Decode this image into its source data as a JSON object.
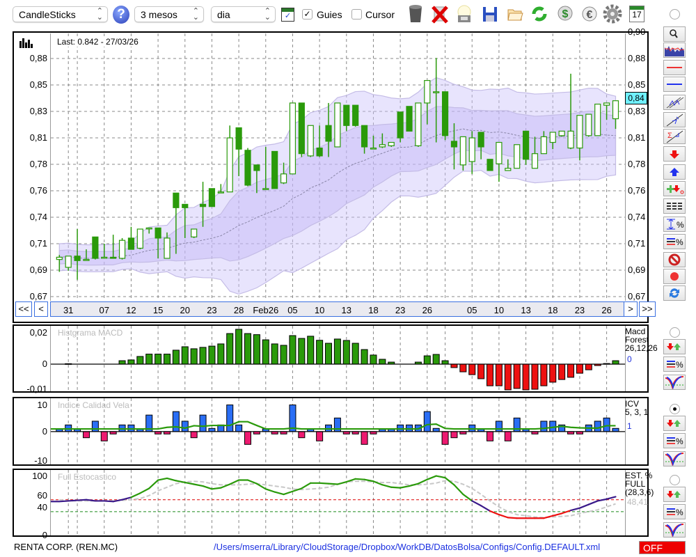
{
  "toolbar": {
    "chart_type": "CandleSticks",
    "period": "3 mesos",
    "interval": "dia",
    "help_label": "?",
    "guides_label": "Guies",
    "guides_checked": true,
    "cursor_label": "Cursor",
    "cursor_checked": false,
    "check_mark": "✓",
    "icons": [
      "chart-window-icon",
      "trash-icon",
      "delete-icon",
      "lightbulb-icon",
      "save-icon",
      "open-folder-icon",
      "refresh-icon",
      "dollar-icon",
      "euro-icon",
      "gear-icon",
      "calendar-icon"
    ],
    "calendar_day": "17"
  },
  "main": {
    "last_info": "Last: 0.842 - 27/03/26",
    "current_price_label": "0,84",
    "nav": {
      "first": "<<",
      "prev": "<",
      "next": ">",
      "last": ">>"
    }
  },
  "panels": {
    "macd": {
      "title": "Histgrama MACD",
      "name": "Macd\nForest\n26,12,26",
      "value": "0"
    },
    "icv": {
      "title": "Indice Calidad Vela",
      "name": "ICV\n5, 3, 1",
      "value": "1"
    },
    "stoch": {
      "title": "Full Estocastico",
      "name": "EST. %\nFULL\n(28,3,6)",
      "value": "48,41"
    }
  },
  "footer": {
    "company": "RENTA CORP. (REN.MC)",
    "config_path": "/Users/mserra/Library/CloudStorage/Dropbox/WorkDB/DatosBolsa/Configs/Config.DEFAULT.xml",
    "status": "OFF"
  },
  "colors": {
    "up_fill": "#ffffff",
    "candle": "#2a9a0a",
    "negative": "#ee1111",
    "icv_pos": "#2a6ef5",
    "icv_neg": "#ee1a70",
    "stoch_mid": "#3a1a8a",
    "cyan": "#6ff0ff"
  },
  "chart_data": [
    {
      "type": "candlestick",
      "title": "Last: 0.842 - 27/03/26",
      "ylim": [
        0.6663,
        0.9038
      ],
      "y_ticks": [
        {
          "v": 0.67,
          "l": "0,67"
        },
        {
          "v": 0.6935,
          "l": "0,69"
        },
        {
          "v": 0.717,
          "l": "0,71"
        },
        {
          "v": 0.7405,
          "l": "0,74"
        },
        {
          "v": 0.764,
          "l": "0,76"
        },
        {
          "v": 0.7875,
          "l": "0,78"
        },
        {
          "v": 0.811,
          "l": "0,81"
        },
        {
          "v": 0.8345,
          "l": "0,83"
        },
        {
          "v": 0.858,
          "l": "0,85"
        },
        {
          "v": 0.8815,
          "l": "0,88"
        },
        {
          "v": 0.905,
          "l": "0,90"
        }
      ],
      "x_labels": [
        {
          "i": 1,
          "l": "31"
        },
        {
          "i": 5,
          "l": "07"
        },
        {
          "i": 8,
          "l": "12"
        },
        {
          "i": 11,
          "l": "15"
        },
        {
          "i": 14,
          "l": "20"
        },
        {
          "i": 17,
          "l": "23"
        },
        {
          "i": 20,
          "l": "28"
        },
        {
          "i": 23,
          "l": "Feb26"
        },
        {
          "i": 26,
          "l": "05"
        },
        {
          "i": 29,
          "l": "10"
        },
        {
          "i": 32,
          "l": "13"
        },
        {
          "i": 35,
          "l": "18"
        },
        {
          "i": 38,
          "l": "23"
        },
        {
          "i": 41,
          "l": "26"
        },
        {
          "i": 46,
          "l": "05"
        },
        {
          "i": 49,
          "l": "10"
        },
        {
          "i": 52,
          "l": "13"
        },
        {
          "i": 55,
          "l": "18"
        },
        {
          "i": 58,
          "l": "23"
        },
        {
          "i": 61,
          "l": "26"
        }
      ],
      "x_grid": [
        1,
        2,
        5,
        8,
        11,
        14,
        17,
        20,
        23,
        26,
        29,
        32,
        35,
        38,
        41,
        43,
        46,
        49,
        52,
        55,
        58,
        61
      ],
      "ohlc": [
        [
          0.703,
          0.707,
          0.692,
          0.705
        ],
        [
          0.696,
          0.706,
          0.693,
          0.706
        ],
        [
          0.706,
          0.73,
          0.685,
          0.702
        ],
        [
          0.703,
          0.712,
          0.703,
          0.703
        ],
        [
          0.723,
          0.723,
          0.703,
          0.704
        ],
        [
          0.705,
          0.717,
          0.705,
          0.705
        ],
        [
          0.705,
          0.725,
          0.704,
          0.704
        ],
        [
          0.704,
          0.722,
          0.703,
          0.72
        ],
        [
          0.722,
          0.732,
          0.712,
          0.712
        ],
        [
          0.713,
          0.73,
          0.712,
          0.73
        ],
        [
          0.731,
          0.731,
          0.726,
          0.731
        ],
        [
          0.731,
          0.731,
          0.704,
          0.722
        ],
        [
          0.704,
          0.727,
          0.704,
          0.722
        ],
        [
          0.762,
          0.762,
          0.708,
          0.749
        ],
        [
          0.752,
          0.752,
          0.722,
          0.749
        ],
        [
          0.723,
          0.73,
          0.722,
          0.73
        ],
        [
          0.752,
          0.772,
          0.732,
          0.75
        ],
        [
          0.766,
          0.766,
          0.75,
          0.75
        ],
        [
          0.763,
          0.77,
          0.762,
          0.763
        ],
        [
          0.763,
          0.822,
          0.763,
          0.811
        ],
        [
          0.82,
          0.82,
          0.777,
          0.801
        ],
        [
          0.8,
          0.802,
          0.768,
          0.769
        ],
        [
          0.787,
          0.787,
          0.762,
          0.782
        ],
        [
          0.766,
          0.803,
          0.766,
          0.766
        ],
        [
          0.799,
          0.799,
          0.766,
          0.766
        ],
        [
          0.771,
          0.789,
          0.77,
          0.779
        ],
        [
          0.779,
          0.842,
          0.779,
          0.842
        ],
        [
          0.842,
          0.842,
          0.794,
          0.797
        ],
        [
          0.795,
          0.822,
          0.794,
          0.822
        ],
        [
          0.802,
          0.822,
          0.794,
          0.795
        ],
        [
          0.822,
          0.842,
          0.794,
          0.808
        ],
        [
          0.803,
          0.842,
          0.803,
          0.842
        ],
        [
          0.84,
          0.84,
          0.817,
          0.822
        ],
        [
          0.84,
          0.84,
          0.821,
          0.822
        ],
        [
          0.822,
          0.822,
          0.797,
          0.803
        ],
        [
          0.802,
          0.813,
          0.802,
          0.802
        ],
        [
          0.803,
          0.815,
          0.802,
          0.805
        ],
        [
          0.804,
          0.807,
          0.803,
          0.807
        ],
        [
          0.834,
          0.834,
          0.807,
          0.811
        ],
        [
          0.839,
          0.839,
          0.817,
          0.817
        ],
        [
          0.804,
          0.842,
          0.803,
          0.842
        ],
        [
          0.842,
          0.862,
          0.823,
          0.862
        ],
        [
          0.852,
          0.882,
          0.807,
          0.852
        ],
        [
          0.852,
          0.852,
          0.809,
          0.813
        ],
        [
          0.808,
          0.824,
          0.783,
          0.803
        ],
        [
          0.787,
          0.812,
          0.782,
          0.812
        ],
        [
          0.79,
          0.817,
          0.779,
          0.811
        ],
        [
          0.816,
          0.816,
          0.792,
          0.803
        ],
        [
          0.792,
          0.792,
          0.782,
          0.782
        ],
        [
          0.788,
          0.807,
          0.772,
          0.807
        ],
        [
          0.782,
          0.792,
          0.782,
          0.784
        ],
        [
          0.784,
          0.805,
          0.784,
          0.805
        ],
        [
          0.817,
          0.817,
          0.787,
          0.792
        ],
        [
          0.784,
          0.812,
          0.784,
          0.797
        ],
        [
          0.797,
          0.817,
          0.797,
          0.812
        ],
        [
          0.807,
          0.816,
          0.801,
          0.816
        ],
        [
          0.813,
          0.817,
          0.812,
          0.817
        ],
        [
          0.802,
          0.868,
          0.801,
          0.817
        ],
        [
          0.802,
          0.831,
          0.791,
          0.831
        ],
        [
          0.813,
          0.832,
          0.812,
          0.832
        ],
        [
          0.813,
          0.841,
          0.813,
          0.841
        ],
        [
          0.84,
          0.842,
          0.827,
          0.842
        ],
        [
          0.828,
          0.844,
          0.819,
          0.844
        ]
      ]
    },
    {
      "type": "bar",
      "title": "Histgrama MACD",
      "ylim": [
        -0.0173,
        0.0244
      ],
      "y_ticks": [
        {
          "v": 0.02,
          "l": "0,02"
        },
        {
          "v": 0,
          "l": "0"
        },
        {
          "v": -0.016,
          "l": "-0,01"
        }
      ],
      "values": [
        0,
        0.0003,
        0,
        0,
        0,
        0,
        0,
        0.0022,
        0.0027,
        0.0049,
        0.0064,
        0.0064,
        0.0064,
        0.0089,
        0.0111,
        0.0098,
        0.0107,
        0.0115,
        0.0129,
        0.0195,
        0.0222,
        0.0195,
        0.0188,
        0.0155,
        0.0129,
        0.012,
        0.0182,
        0.0164,
        0.0178,
        0.0152,
        0.0133,
        0.016,
        0.0151,
        0.0133,
        0.0093,
        0.0058,
        0.0031,
        0.0013,
        0,
        0,
        0.0013,
        0.0053,
        0.0062,
        0.0022,
        -0.0022,
        -0.0049,
        -0.0067,
        -0.0093,
        -0.0138,
        -0.0138,
        -0.0164,
        -0.0155,
        -0.0164,
        -0.016,
        -0.0138,
        -0.0115,
        -0.0098,
        -0.0084,
        -0.0058,
        -0.0036,
        -0.0009,
        0.0004,
        0.0022
      ]
    },
    {
      "type": "bar",
      "title": "Indice Calidad Vela",
      "ylim": [
        -12.3,
        12.5
      ],
      "y_ticks": [
        {
          "v": 10,
          "l": "10"
        },
        {
          "v": 0,
          "l": "0"
        },
        {
          "v": -11,
          "l": "-10"
        }
      ],
      "values": [
        1,
        2.5,
        1,
        -2.3,
        3.9,
        -3.5,
        -0.9,
        2.5,
        2.5,
        1,
        6.2,
        -0.9,
        -0.9,
        7.5,
        3.9,
        -2.3,
        6.2,
        1.2,
        2.5,
        10,
        2.5,
        -4.8,
        -0.9,
        1,
        -0.9,
        -0.9,
        10,
        -2.3,
        1,
        -3.5,
        2.5,
        5.1,
        -0.9,
        -0.9,
        -4.8,
        -0.9,
        1,
        1,
        2.5,
        2.5,
        2.5,
        7.5,
        1.2,
        -4.8,
        -2.3,
        -0.9,
        2.5,
        1,
        -3.5,
        3.9,
        -3.5,
        5.1,
        1,
        -0.9,
        3.9,
        3.9,
        2.5,
        -0.9,
        -0.9,
        2.5,
        3.9,
        5.1,
        1.2
      ],
      "signal": [
        1,
        1,
        1,
        1,
        1,
        1,
        1,
        1,
        1,
        1,
        1,
        1,
        1.6,
        1.8,
        1.3,
        2.2,
        2.0,
        2.3,
        2.3,
        2.3,
        3.7,
        3.7,
        2.3,
        1,
        1,
        1,
        1.3,
        1,
        1,
        1,
        1,
        1,
        1,
        1,
        1,
        1,
        1,
        1,
        1,
        1,
        1,
        2.6,
        2.8,
        1.2,
        1,
        1,
        1,
        1,
        1,
        1,
        1,
        1,
        1,
        1,
        1.2,
        1.6,
        2.0,
        1.6,
        1.4,
        1.3,
        1.3,
        2.2,
        2.2
      ]
    },
    {
      "type": "line",
      "title": "Full Estocastico",
      "ylim": [
        0,
        110
      ],
      "y_ticks": [
        {
          "v": 100,
          "l": "100"
        },
        {
          "v": 60,
          "l": "60"
        },
        {
          "v": 40,
          "l": "40"
        },
        {
          "v": 0,
          "l": "0"
        }
      ],
      "thresholds": {
        "upper": 60,
        "lower": 40
      },
      "series": [
        {
          "name": "%K",
          "values": [
            57,
            58,
            59,
            60,
            58,
            58,
            57,
            60,
            64,
            71,
            79,
            93,
            96,
            92,
            89,
            86,
            83,
            78,
            80,
            86,
            93,
            93,
            87,
            78,
            73,
            69,
            74,
            79,
            88,
            88,
            87,
            86,
            90,
            95,
            94,
            91,
            85,
            81,
            80,
            83,
            87,
            94,
            100,
            97,
            85,
            69,
            58,
            50,
            41,
            35,
            30,
            29,
            29,
            29,
            29,
            33,
            37,
            42,
            46,
            52,
            58,
            61,
            65
          ]
        },
        {
          "name": "%D",
          "values": [
            60,
            58,
            58,
            58,
            58,
            58,
            58,
            59,
            60,
            62,
            67,
            75,
            81,
            87,
            90,
            91,
            90,
            87,
            85,
            85,
            85,
            86,
            87,
            85,
            83,
            81,
            78,
            77,
            78,
            79,
            81,
            86,
            90,
            91,
            91,
            90,
            89,
            89,
            87,
            85,
            85,
            86,
            88,
            92,
            91,
            86,
            79,
            69,
            58,
            48,
            40,
            35,
            33,
            31,
            30,
            31,
            32,
            33,
            37,
            40,
            43,
            48,
            53
          ]
        }
      ]
    }
  ]
}
